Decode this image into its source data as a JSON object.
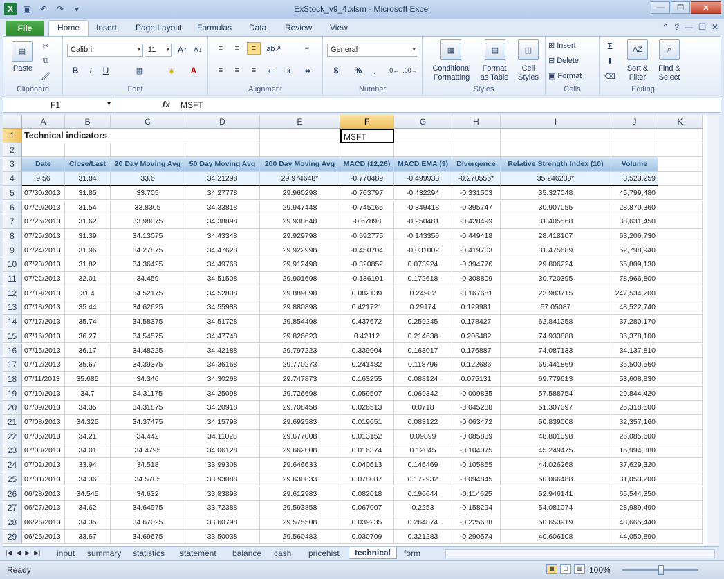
{
  "window": {
    "title": "ExStock_v9_4.xlsm - Microsoft Excel"
  },
  "ribbon_tabs": {
    "file": "File",
    "tabs": [
      "Home",
      "Insert",
      "Page Layout",
      "Formulas",
      "Data",
      "Review",
      "View"
    ]
  },
  "ribbon": {
    "clipboard": {
      "paste": "Paste",
      "label": "Clipboard"
    },
    "font": {
      "name": "Calibri",
      "size": "11",
      "label": "Font",
      "bold": "B",
      "italic": "I",
      "underline": "U"
    },
    "alignment": {
      "label": "Alignment"
    },
    "number": {
      "format": "General",
      "label": "Number",
      "currency": "$",
      "percent": "%",
      "comma": ","
    },
    "styles": {
      "cond": "Conditional",
      "cond2": "Formatting",
      "fmt": "Format",
      "fmt2": "as Table",
      "cell": "Cell",
      "cell2": "Styles",
      "label": "Styles"
    },
    "cells": {
      "insert": "Insert",
      "delete": "Delete",
      "format": "Format",
      "label": "Cells"
    },
    "editing": {
      "sort": "Sort &",
      "sort2": "Filter",
      "find": "Find &",
      "find2": "Select",
      "label": "Editing"
    }
  },
  "formula_bar": {
    "name_box": "F1",
    "fx": "fx",
    "content": "MSFT"
  },
  "columns": [
    "A",
    "B",
    "C",
    "D",
    "E",
    "F",
    "G",
    "H",
    "I",
    "J",
    "K"
  ],
  "rows": [
    "1",
    "2",
    "3",
    "4",
    "5",
    "6",
    "7",
    "8",
    "9",
    "10",
    "11",
    "12",
    "13",
    "14",
    "15",
    "16",
    "17",
    "18",
    "19",
    "20",
    "21",
    "22",
    "23",
    "24",
    "25",
    "26",
    "27",
    "28",
    "29"
  ],
  "sheet": {
    "title": "Technical indicators",
    "symbol": "MSFT",
    "headers": [
      "Date",
      "Close/Last",
      "20 Day Moving Avg",
      "50 Day Moving Avg",
      "200 Day Moving Avg",
      "MACD (12,26)",
      "MACD EMA (9)",
      "Divergence",
      "Relative Strength Index (10)",
      "Volume"
    ],
    "data": [
      [
        "9:56",
        "31.84",
        "33.6",
        "34.21298",
        "29.974648*",
        "-0.770489",
        "-0.499933",
        "-0.270556*",
        "35.246233*",
        "3,523,259"
      ],
      [
        "07/30/2013",
        "31.85",
        "33.705",
        "34.27778",
        "29.960298",
        "-0.763797",
        "-0.432294",
        "-0.331503",
        "35.327048",
        "45,799,480"
      ],
      [
        "07/29/2013",
        "31.54",
        "33.8305",
        "34.33818",
        "29.947448",
        "-0.745165",
        "-0.349418",
        "-0.395747",
        "30.907055",
        "28,870,360"
      ],
      [
        "07/26/2013",
        "31.62",
        "33.98075",
        "34.38898",
        "29.938648",
        "-0.67898",
        "-0.250481",
        "-0.428499",
        "31.405568",
        "38,631,450"
      ],
      [
        "07/25/2013",
        "31.39",
        "34.13075",
        "34.43348",
        "29.929798",
        "-0.592775",
        "-0.143356",
        "-0.449418",
        "28.418107",
        "63,206,730"
      ],
      [
        "07/24/2013",
        "31.96",
        "34.27875",
        "34.47628",
        "29.922998",
        "-0.450704",
        "-0.031002",
        "-0.419703",
        "31.475689",
        "52,798,940"
      ],
      [
        "07/23/2013",
        "31.82",
        "34.36425",
        "34.49768",
        "29.912498",
        "-0.320852",
        "0.073924",
        "-0.394776",
        "29.806224",
        "65,809,130"
      ],
      [
        "07/22/2013",
        "32.01",
        "34.459",
        "34.51508",
        "29.901698",
        "-0.136191",
        "0.172618",
        "-0.308809",
        "30.720395",
        "78,966,800"
      ],
      [
        "07/19/2013",
        "31.4",
        "34.52175",
        "34.52808",
        "29.889098",
        "0.082139",
        "0.24982",
        "-0.167681",
        "23.983715",
        "247,534,200"
      ],
      [
        "07/18/2013",
        "35.44",
        "34.62625",
        "34.55988",
        "29.880898",
        "0.421721",
        "0.29174",
        "0.129981",
        "57.05087",
        "48,522,740"
      ],
      [
        "07/17/2013",
        "35.74",
        "34.58375",
        "34.51728",
        "29.854498",
        "0.437672",
        "0.259245",
        "0.178427",
        "62.841258",
        "37,280,170"
      ],
      [
        "07/16/2013",
        "36.27",
        "34.54575",
        "34.47748",
        "29.826623",
        "0.42112",
        "0.214638",
        "0.206482",
        "74.933888",
        "36,378,100"
      ],
      [
        "07/15/2013",
        "36.17",
        "34.48225",
        "34.42188",
        "29.797223",
        "0.339904",
        "0.163017",
        "0.176887",
        "74.087133",
        "34,137,810"
      ],
      [
        "07/12/2013",
        "35.67",
        "34.39375",
        "34.36168",
        "29.770273",
        "0.241482",
        "0.118796",
        "0.122686",
        "69.441869",
        "35,500,560"
      ],
      [
        "07/11/2013",
        "35.685",
        "34.346",
        "34.30268",
        "29.747873",
        "0.163255",
        "0.088124",
        "0.075131",
        "69.779613",
        "53,608,830"
      ],
      [
        "07/10/2013",
        "34.7",
        "34.31175",
        "34.25098",
        "29.726698",
        "0.059507",
        "0.069342",
        "-0.009835",
        "57.588754",
        "29,844,420"
      ],
      [
        "07/09/2013",
        "34.35",
        "34.31875",
        "34.20918",
        "29.708458",
        "0.026513",
        "0.0718",
        "-0.045288",
        "51.307097",
        "25,318,500"
      ],
      [
        "07/08/2013",
        "34.325",
        "34.37475",
        "34.15798",
        "29.692583",
        "0.019651",
        "0.083122",
        "-0.063472",
        "50.839008",
        "32,357,160"
      ],
      [
        "07/05/2013",
        "34.21",
        "34.442",
        "34.11028",
        "29.677008",
        "0.013152",
        "0.09899",
        "-0.085839",
        "48.801398",
        "26,085,600"
      ],
      [
        "07/03/2013",
        "34.01",
        "34.4795",
        "34.06128",
        "29.662008",
        "0.016374",
        "0.12045",
        "-0.104075",
        "45.249475",
        "15,994,380"
      ],
      [
        "07/02/2013",
        "33.94",
        "34.518",
        "33.99308",
        "29.646633",
        "0.040613",
        "0.146469",
        "-0.105855",
        "44.026268",
        "37,629,320"
      ],
      [
        "07/01/2013",
        "34.36",
        "34.5705",
        "33.93088",
        "29.630833",
        "0.078087",
        "0.172932",
        "-0.094845",
        "50.066488",
        "31,053,200"
      ],
      [
        "06/28/2013",
        "34.545",
        "34.632",
        "33.83898",
        "29.612983",
        "0.082018",
        "0.196644",
        "-0.114625",
        "52.946141",
        "65,544,350"
      ],
      [
        "06/27/2013",
        "34.62",
        "34.64975",
        "33.72388",
        "29.593858",
        "0.067007",
        "0.2253",
        "-0.158294",
        "54.081074",
        "28,989,490"
      ],
      [
        "06/26/2013",
        "34.35",
        "34.67025",
        "33.60798",
        "29.575508",
        "0.039235",
        "0.264874",
        "-0.225638",
        "50.653919",
        "48,665,440"
      ],
      [
        "06/25/2013",
        "33.67",
        "34.69675",
        "33.50038",
        "29.560483",
        "0.030709",
        "0.321283",
        "-0.290574",
        "40.606108",
        "44,050,890"
      ]
    ]
  },
  "sheet_tabs": [
    "input",
    "summary",
    "statistics",
    "statement",
    "balance",
    "cash",
    "pricehist",
    "technical",
    "form"
  ],
  "active_sheet": "technical",
  "status": {
    "ready": "Ready",
    "zoom": "100%"
  },
  "colors": {
    "header_fill": "#a6c7e6",
    "header_text": "#1f4e79",
    "selection": "#f1c15f"
  }
}
